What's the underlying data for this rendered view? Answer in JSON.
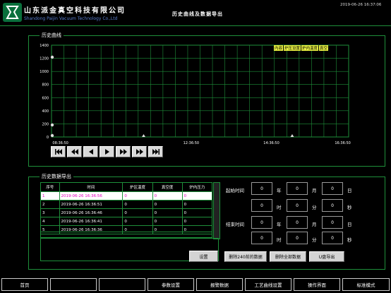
{
  "header": {
    "company_cn": "山东派金真空科技有限公司",
    "company_en": "Shandong Paijin Vacuum Technology Co.,Ltd",
    "title": "历史曲线及数据导出",
    "datetime": "2019-06-26 16:37:06"
  },
  "history_curve": {
    "title": "历史曲线",
    "legend": [
      "内容",
      "炉压设置",
      "炉内温度",
      "真空"
    ],
    "nav_buttons": [
      "first-page",
      "prev-fast",
      "prev",
      "play",
      "next",
      "next-fast",
      "last-page"
    ]
  },
  "chart_data": {
    "type": "line",
    "y_ticks": [
      "1400",
      "1200",
      "1000",
      "800",
      "600",
      "400",
      "200",
      "0"
    ],
    "x_ticks": [
      "08:36:50",
      "12:36:50",
      "14:36:50",
      "16:36:50"
    ],
    "ylim": [
      0,
      1400
    ],
    "grid": true
  },
  "data_export": {
    "title": "历史数据导出",
    "columns": [
      "序号",
      "时间",
      "炉区温度",
      "真空度",
      "炉内压力"
    ],
    "rows": [
      {
        "idx": "1",
        "time": "2019-06-26 16:36:56",
        "temp": "0",
        "vac": "0",
        "press": "0"
      },
      {
        "idx": "2",
        "time": "2019-06-26 16:36:51",
        "temp": "0",
        "vac": "0",
        "press": "0"
      },
      {
        "idx": "3",
        "time": "2019-06-26 16:36:46",
        "temp": "0",
        "vac": "0",
        "press": "0"
      },
      {
        "idx": "4",
        "time": "2019-06-26 16:36:41",
        "temp": "0",
        "vac": "0",
        "press": "0"
      },
      {
        "idx": "5",
        "time": "2019-06-26 16:36:36",
        "temp": "0",
        "vac": "0",
        "press": "0"
      }
    ],
    "settings_button": "设置",
    "start_label": "起始时间",
    "end_label": "结束时间",
    "unit_year": "年",
    "unit_month": "月",
    "unit_day": "日",
    "unit_hour": "时",
    "unit_minute": "分",
    "unit_second": "秒",
    "start_values": {
      "year": "0",
      "month": "0",
      "day": "0",
      "hour": "0",
      "minute": "0",
      "second": "0"
    },
    "end_values": {
      "year": "0",
      "month": "0",
      "day": "0",
      "hour": "0",
      "minute": "0",
      "second": "0"
    },
    "delete_240_button": "删除240前的数据",
    "delete_all_button": "删除全部数据",
    "usb_export_button": "U盘导出"
  },
  "footer": {
    "buttons": [
      "首页",
      "",
      "",
      "参数设置",
      "报警数据",
      "工艺曲线设置",
      "操作界面",
      "标准模式"
    ]
  },
  "colors": {
    "border_green": "#1e8f3a",
    "grid_green": "#1e8f3a",
    "legend_yellow": "#e8f040",
    "selected_text": "#e000c0"
  }
}
